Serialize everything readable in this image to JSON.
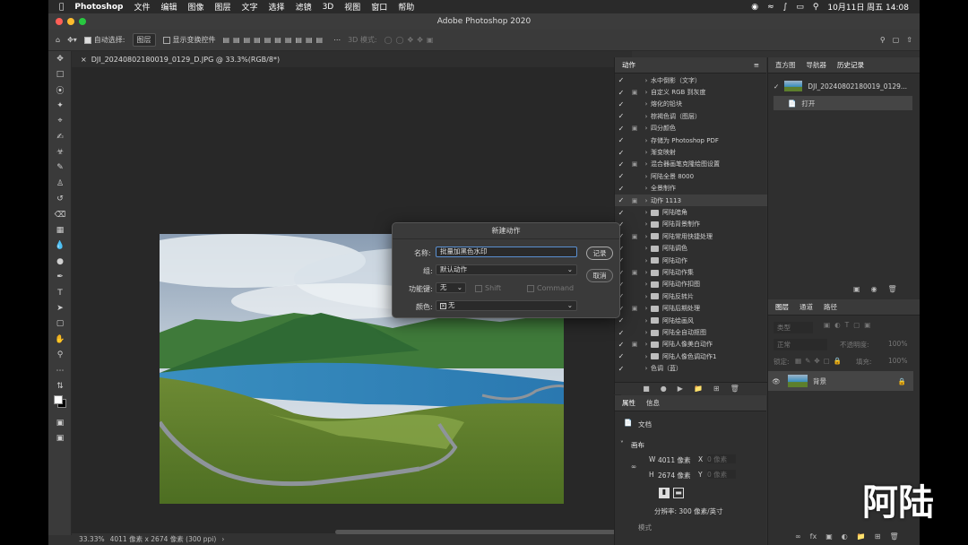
{
  "menubar": {
    "app": "Photoshop",
    "menus": [
      "文件",
      "编辑",
      "图像",
      "图层",
      "文字",
      "选择",
      "滤镜",
      "3D",
      "视图",
      "窗口",
      "帮助"
    ],
    "clock": "10月11日 周五  14:08"
  },
  "window": {
    "title": "Adobe Photoshop 2020"
  },
  "options": {
    "auto_select_label": "自动选择:",
    "auto_select_value": "图层",
    "transform_label": "显示变换控件",
    "mode_3d": "3D 模式:"
  },
  "document": {
    "tab_title": "DJI_20240802180019_0129_D.JPG @ 33.3%(RGB/8*)",
    "zoom": "33.33%",
    "size_info": "4011 像素 x 2674 像素 (300 ppi)"
  },
  "actions_panel": {
    "tab": "动作",
    "rows": [
      {
        "label": "水中倒影（文字）",
        "folder": false
      },
      {
        "label": "自定义 RGB 到灰度",
        "folder": false
      },
      {
        "label": "熔化的铅块",
        "folder": false
      },
      {
        "label": "棕褐色调（图层）",
        "folder": false
      },
      {
        "label": "四分颜色",
        "folder": false
      },
      {
        "label": "存储为 Photoshop PDF",
        "folder": false
      },
      {
        "label": "渐变映射",
        "folder": false
      },
      {
        "label": "混合器画笔克隆绘图设置",
        "folder": false
      },
      {
        "label": "阿陆全景 8000",
        "folder": false
      },
      {
        "label": "全景制作",
        "folder": false
      },
      {
        "label": "动作 1113",
        "folder": false
      },
      {
        "label": "阿陆暗角",
        "folder": true
      },
      {
        "label": "阿陆背景制作",
        "folder": true
      },
      {
        "label": "阿陆常用快捷处理",
        "folder": true
      },
      {
        "label": "阿陆调色",
        "folder": true
      },
      {
        "label": "阿陆动作",
        "folder": true
      },
      {
        "label": "阿陆动作集",
        "folder": true
      },
      {
        "label": "阿陆动作扣图",
        "folder": true
      },
      {
        "label": "阿陆反转片",
        "folder": true
      },
      {
        "label": "阿陆后期处理",
        "folder": true
      },
      {
        "label": "阿陆绘画风",
        "folder": true
      },
      {
        "label": "阿陆全自动抠图",
        "folder": true
      },
      {
        "label": "阿陆人像美白动作",
        "folder": true
      },
      {
        "label": "阿陆人像色调动作1",
        "folder": true
      },
      {
        "label": "色调（蓝）",
        "folder": false
      }
    ]
  },
  "properties_panel": {
    "tabs": [
      "属性",
      "信息"
    ],
    "doc_label": "文档",
    "canvas_label": "画布",
    "w_label": "W",
    "w_value": "4011 像素",
    "h_label": "H",
    "h_value": "2674 像素",
    "x_label": "X",
    "x_placeholder": "0 像素",
    "y_label": "Y",
    "y_placeholder": "0 像素",
    "resolution": "分辨率: 300 像素/英寸",
    "mode_label": "模式"
  },
  "history_panel": {
    "tabs": [
      "直方图",
      "导航器",
      "历史记录"
    ],
    "snapshot": "DJI_20240802180019_0129...",
    "step": "打开"
  },
  "layers_panel": {
    "tabs": [
      "图层",
      "通道",
      "路径"
    ],
    "filter": "类型",
    "blend": "正常",
    "opacity_label": "不透明度:",
    "opacity": "100%",
    "lock_label": "锁定:",
    "fill_label": "填充:",
    "fill": "100%",
    "layer_name": "背景"
  },
  "dialog": {
    "title": "新建动作",
    "name_label": "名称:",
    "name_value": "批量加黑色水印",
    "group_label": "组:",
    "group_value": "默认动作",
    "fkey_label": "功能键:",
    "fkey_value": "无",
    "shift_label": "Shift",
    "command_label": "Command",
    "color_label": "颜色:",
    "color_value": "无",
    "record_button": "记录",
    "cancel_button": "取消"
  },
  "watermark": "阿陆"
}
